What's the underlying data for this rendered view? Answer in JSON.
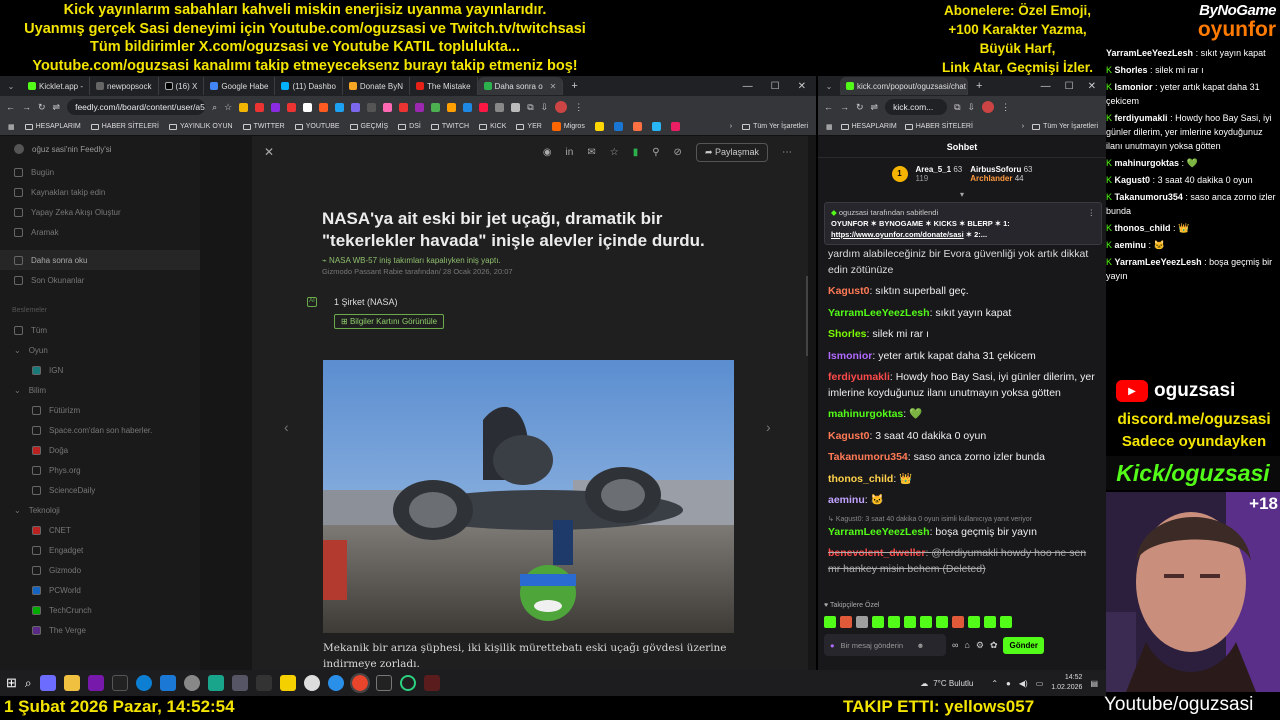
{
  "banner": {
    "lines": [
      "Kick yayınlarım sabahları kahveli miskin enerjisiz uyanma yayınlarıdır.",
      "Uyanmış gerçek Sasi deneyimi için Youtube.com/oguzsasi ve Twitch.tv/twitchsasi",
      "Tüm bildirimler X.com/oguzsasi ve Youtube KATIL toplulukta...",
      "Youtube.com/oguzsasi kanalımı takip etmeyeceksenz burayı takip etmeniz boş!"
    ],
    "right_lines": [
      "Abonelere: Özel Emoji,",
      "+100 Karakter Yazma,",
      "Büyük Harf,",
      "Link Atar, Geçmişi İzler."
    ],
    "logo_top": "ByNoGame",
    "logo_bottom": "oyunfor"
  },
  "left_browser": {
    "tabs": [
      {
        "label": "Kicklet.app -",
        "color": "#53fc18"
      },
      {
        "label": "newpopsock",
        "color": "#777"
      },
      {
        "label": "(16) X",
        "color": "#000"
      },
      {
        "label": "Google Habe",
        "color": "#4285f4"
      },
      {
        "label": "(11) Dashbo",
        "color": "#00b2ff"
      },
      {
        "label": "Donate ByN",
        "color": "#f6a623"
      },
      {
        "label": "The Mistake",
        "color": "#e62117"
      },
      {
        "label": "Daha sonra o",
        "color": "#2bb24c"
      }
    ],
    "url": "feedly.com/i/board/content/user/a5",
    "bookmarks": [
      "HESAPLARIM",
      "HABER SİTELERİ",
      "YAYINLIK OYUN",
      "TWITTER",
      "YOUTUBE",
      "GEÇMİŞ",
      "DSİ",
      "TWITCH",
      "KICK",
      "YER",
      "Migros"
    ],
    "bookmarks_right": "Tüm Yer İşaretleri"
  },
  "feedly": {
    "workspace": "oğuz sasi'nin Feedly'si",
    "nav": [
      "Bugün",
      "Kaynakları takip edin",
      "Yapay Zeka Akışı Oluştur",
      "Aramak"
    ],
    "saved": [
      "Daha sonra oku",
      "Son Okunanlar"
    ],
    "section_label": "Beslemeler",
    "feeds": [
      {
        "label": "Tüm",
        "sub": false
      },
      {
        "label": "Oyun",
        "sub": false
      },
      {
        "label": "IGN",
        "sub": true
      },
      {
        "label": "Bilim",
        "sub": false
      },
      {
        "label": "Fütürizm",
        "sub": true
      },
      {
        "label": "Space.com'dan son haberler.",
        "sub": true
      },
      {
        "label": "Doğa",
        "sub": true
      },
      {
        "label": "Phys.org",
        "sub": true
      },
      {
        "label": "ScienceDaily",
        "sub": true
      },
      {
        "label": "Teknoloji",
        "sub": false
      },
      {
        "label": "CNET",
        "sub": true
      },
      {
        "label": "Engadget",
        "sub": true
      },
      {
        "label": "Gizmodo",
        "sub": true
      },
      {
        "label": "PCWorld",
        "sub": true
      },
      {
        "label": "TechCrunch",
        "sub": true
      },
      {
        "label": "The Verge",
        "sub": true
      }
    ],
    "share_label": "Paylaşmak",
    "title": "NASA'ya ait eski bir jet uçağı, dramatik bir \"tekerlekler havada\" inişle alevler içinde durdu.",
    "subtitle": "NASA WB-57 iniş takımları kapalıyken iniş yaptı.",
    "byline": "Gizmodo Passant Rabie tarafından/ 28 Ocak 2026, 20:07",
    "entity": "1 Şirket (NASA)",
    "entity_button": "Bilgiler Kartını Görüntüle",
    "body": "Mekanik bir arıza şüphesi, iki kişilik mürettebatı eski uçağı gövdesi üzerine indirmeye zorladı."
  },
  "right_browser": {
    "url": "kick.com/popout/oguzsasi/chat",
    "url_short": "kick.com...",
    "panel_title": "Sohbet",
    "leaderboard": [
      {
        "name": "Area_5_1",
        "count": "63",
        "sub": "119"
      },
      {
        "name": "AirbusSoforu",
        "count": "63"
      },
      {
        "name": "Archlander",
        "count": "44"
      }
    ],
    "pinned_by": "oguzsasi tarafından sabitlendi",
    "pinned_text": "OYUNFOR ✶ BYNOGAME ✶ KICKS ✶ BLERP ✶ 1:",
    "pinned_link": "https://www.oyunfor.com/donate/sasi",
    "pinned_more": "✶ 2:...",
    "first_line": "yardım alabileceğiniz bir Evora güvenliği yok artık dikkat edin zötünüze",
    "messages": [
      {
        "user": "Kagust0",
        "color": "#ff7a55",
        "text": "sıktın superball geç."
      },
      {
        "user": "YarramLeeYeezLesh",
        "color": "#53fc18",
        "text": "sıkıt yayın kapat"
      },
      {
        "user": "Shorles",
        "color": "#7cfc00",
        "text": "silek mi rar ı"
      },
      {
        "user": "Ismonior",
        "color": "#b06aff",
        "text": "yeter artık kapat daha 31 çekicem"
      },
      {
        "user": "ferdiyumakli",
        "color": "#ff4a4a",
        "text": "Howdy hoo Bay Sasi, iyi günler dilerim, yer imlerine koyduğunuz ilanı unutmayın yoksa götten"
      },
      {
        "user": "mahinurgoktas",
        "color": "#53fc18",
        "text": "💚"
      },
      {
        "user": "Kagust0",
        "color": "#ff7a55",
        "text": "3 saat 40 dakika 0 oyun"
      },
      {
        "user": "Takanumoru354",
        "color": "#ff7a55",
        "text": "saso anca zorno izler bunda"
      },
      {
        "user": "thonos_child",
        "color": "#ffd24a",
        "text": "👑"
      },
      {
        "user": "aeminu",
        "color": "#c1a3ff",
        "text": "🐱"
      }
    ],
    "reply_note": "Kagust0: 3 saat 40 dakika 0 oyun isimli kullanıcıya yanıt veriyor",
    "reply_message": {
      "user": "YarramLeeYeezLesh",
      "text": "boşa geçmiş bir yayın"
    },
    "deleted_message": {
      "user": "benevolent_dweller",
      "text": "@ferdiyumakli howdy hoo ne sen mr hankey misin behem",
      "suffix": "(Deleted)"
    },
    "followers_label": "Takipçilere Özel",
    "input_placeholder": "Bir mesaj gönderin",
    "send_label": "Gönder"
  },
  "overlay_chat": [
    {
      "user": "YarramLeeYeezLesh",
      "text": "sıkıt yayın kapat"
    },
    {
      "user": "Shorles",
      "text": "silek mi rar ı"
    },
    {
      "user": "Ismonior",
      "text": "yeter artık kapat daha 31 çekicem"
    },
    {
      "user": "ferdiyumakli",
      "text": "Howdy hoo Bay Sasi, iyi günler dilerim, yer imlerine koyduğunuz ilanı unutmayın yoksa götten"
    },
    {
      "user": "mahinurgoktas",
      "text": "💚"
    },
    {
      "user": "Kagust0",
      "text": "3 saat 40 dakika 0 oyun"
    },
    {
      "user": "Takanumoru354",
      "text": "saso anca zorno izler bunda"
    },
    {
      "user": "thonos_child",
      "text": "👑"
    },
    {
      "user": "aeminu",
      "text": "🐱"
    },
    {
      "user": "YarramLeeYeezLesh",
      "text": "boşa geçmiş bir yayın"
    }
  ],
  "socials": {
    "youtube": "oguzsasi",
    "discord": "discord.me/oguzsasi",
    "discord_note": "Sadece oyundayken",
    "kick": "Kick/oguzsasi",
    "age": "+18"
  },
  "taskbar": {
    "weather": "7°C  Bulutlu",
    "time": "14:52",
    "date": "1.02.2026"
  },
  "bottom": {
    "datetime": "1 Şubat 2026 Pazar, 14:52:54",
    "follow": "TAKIP ETTI: yellows057",
    "youtube": "Youtube/oguzsasi"
  }
}
